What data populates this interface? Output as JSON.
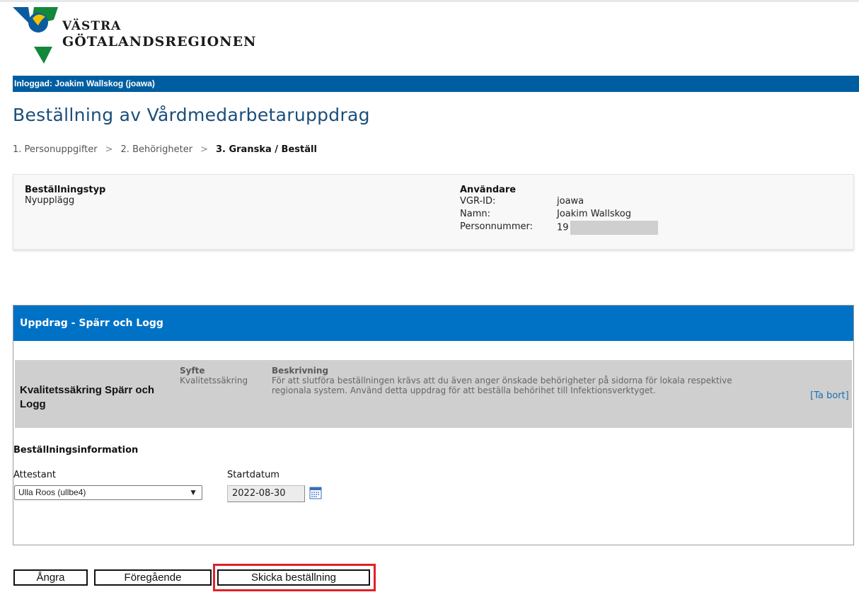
{
  "brand": {
    "name_line1": "VÄSTRA",
    "name_line2": "GÖTALANDSREGIONEN",
    "colors": {
      "blue": "#0b5c9e",
      "green": "#13883b",
      "yellow": "#f2c200"
    }
  },
  "login_bar": {
    "text": "Inloggad: Joakim Wallskog (joawa)",
    "color": "#005ea0"
  },
  "page": {
    "title": "Beställning av Vårdmedarbetaruppdrag"
  },
  "breadcrumb": {
    "steps": [
      "1. Personuppgifter",
      "2. Behörigheter",
      "3. Granska / Beställ"
    ],
    "separator": ">",
    "current_index": 2
  },
  "summary": {
    "order_type_heading": "Beställningstyp",
    "order_type_value": "Nyupplägg",
    "user_heading": "Användare",
    "fields": [
      {
        "label": "VGR-ID:",
        "value": "joawa"
      },
      {
        "label": "Namn:",
        "value": "Joakim Wallskog"
      },
      {
        "label": "Personnummer:",
        "value": "19"
      }
    ]
  },
  "assignment_panel": {
    "header": "Uppdrag - Spärr och Logg",
    "header_color": "#0072c6",
    "assignment": {
      "name": "Kvalitetssäkring Spärr och Logg",
      "syfte_label": "Syfte",
      "syfte_value": "Kvalitetssäkring",
      "beskrivning_label": "Beskrivning",
      "beskrivning_value": "För att slutföra beställningen krävs att du även anger önskade behörigheter på sidorna för lokala respektive regionala system. Använd detta uppdrag för att beställa behörihet till Infektionsverktyget.",
      "remove_link": "[Ta bort]"
    },
    "order_info_title": "Beställningsinformation",
    "attestant_label": "Attestant",
    "attestant_value": "Ulla Roos (ullbe4)",
    "start_label": "Startdatum",
    "start_value": "2022-08-30",
    "calendar_icon": "calendar-icon"
  },
  "buttons": {
    "undo": "Ångra",
    "previous": "Föregående",
    "send": "Skicka beställning"
  },
  "highlight_color": "#e32025"
}
